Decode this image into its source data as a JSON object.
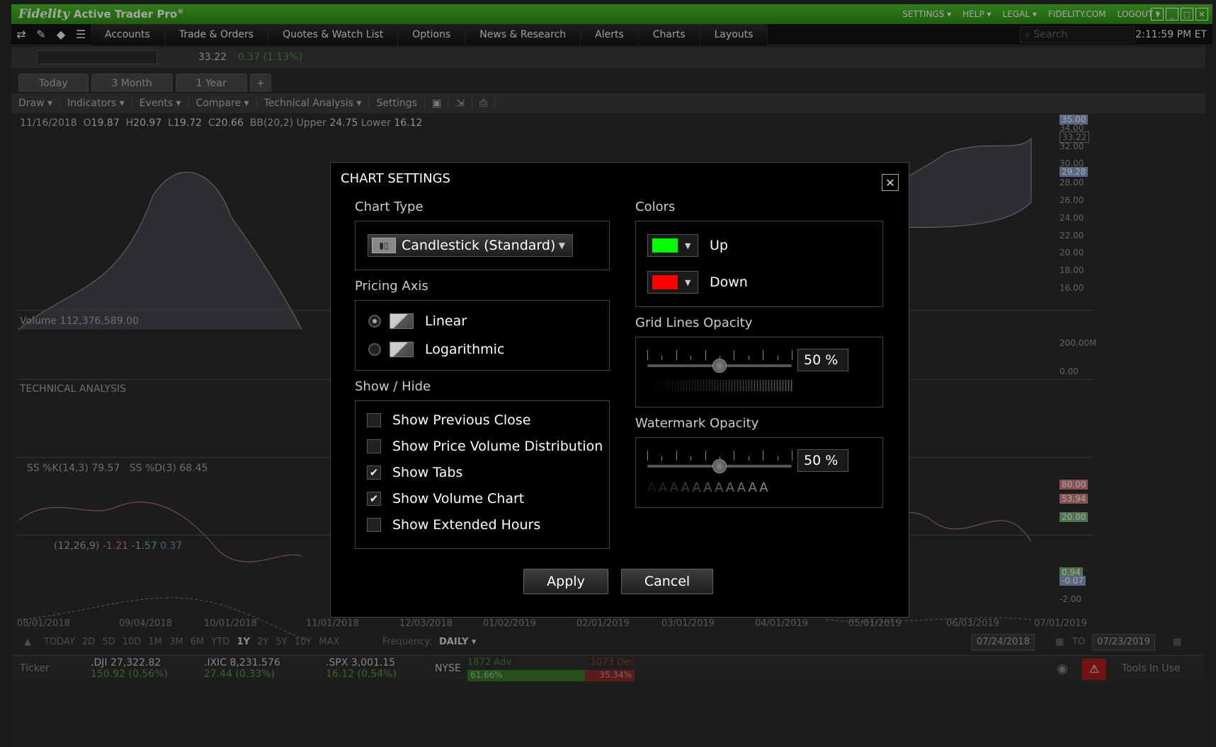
{
  "app": {
    "brand": "Fidelity",
    "title": "Active Trader Pro",
    "reg": "®",
    "top_links": [
      "SETTINGS ▾",
      "HELP ▾",
      "LEGAL ▾",
      "FIDELITY.COM",
      "LOGOUT ▾"
    ],
    "time": "2:11:59 PM ET"
  },
  "menu": {
    "items": [
      "Accounts",
      "Trade & Orders",
      "Quotes & Watch List",
      "Options",
      "News & Research",
      "Alerts",
      "Charts",
      "Layouts"
    ],
    "search_placeholder": "Search"
  },
  "chart": {
    "price": "33.22",
    "change": "0.37 (1.13%)",
    "tabs": [
      "Today",
      "3 Month",
      "1 Year",
      "+"
    ],
    "tools": [
      "Draw ▾",
      "Indicators ▾",
      "Events ▾",
      "Compare ▾",
      "Technical Analysis ▾",
      "Settings"
    ],
    "ohlc": {
      "date": "11/16/2018",
      "open_label": "O",
      "open": "19.87",
      "high_label": "H",
      "high": "20.97",
      "low_label": "L",
      "low": "19.72",
      "close_label": "C",
      "close": "20.66",
      "bb_label": "BB(20,2) Upper",
      "bb_upper": "24.75",
      "bb_lower_label": "Lower",
      "bb_lower": "16.12"
    },
    "volume_label": "Volume",
    "volume_value": "112,376,589.00",
    "technical_analysis_label": "TECHNICAL ANALYSIS",
    "stoch_k_label": "SS %K(14,3)",
    "stoch_k": "79.57",
    "stoch_d_label": "SS %D(3)",
    "stoch_d": "68.45",
    "macd_label": "(12,26,9)",
    "macd_values": [
      "-1.21",
      "-1.57",
      "0.37"
    ],
    "price_axis": [
      "35.00",
      "34.00",
      "33.22",
      "32.00",
      "30.00",
      "29.28",
      "28.00",
      "26.00",
      "24.00",
      "22.00",
      "20.00",
      "18.00",
      "16.00"
    ],
    "volume_axis": [
      "200.00M",
      "0.00"
    ],
    "stoch_axis": [
      "80.00",
      "53.94",
      "20.00"
    ],
    "macd_axis": [
      "0.94",
      "-0.07",
      "-2.00"
    ],
    "x_axis": [
      "08/01/2018",
      "09/04/2018",
      "10/01/2018",
      "11/01/2018",
      "12/03/2018",
      "01/02/2019",
      "02/01/2019",
      "03/01/2019",
      "04/01/2019",
      "05/01/2019",
      "06/03/2019",
      "07/01/2019"
    ],
    "periods": [
      "TODAY",
      "2D",
      "5D",
      "10D",
      "1M",
      "3M",
      "6M",
      "YTD",
      "1Y",
      "2Y",
      "5Y",
      "10Y",
      "MAX"
    ],
    "frequency_label": "Frequency:",
    "frequency": "DAILY ▾",
    "date_from": "07/24/2018",
    "date_to_label": "TO",
    "date_to": "07/23/2019"
  },
  "ticker": {
    "label": "Ticker",
    "items": [
      {
        "sym": ".DJI",
        "val": "27,322.82",
        "chg": "150.92 (0.56%)"
      },
      {
        "sym": ".IXIC",
        "val": "8,231.576",
        "chg": "27.44 (0.33%)"
      },
      {
        "sym": ".SPX",
        "val": "3,001.15",
        "chg": "16.12 (0.54%)"
      }
    ],
    "nyse_label": "NYSE",
    "adv": "1872 Adv",
    "adv_pct": "61.66%",
    "dec": "1073 Dec",
    "dec_pct": "35.34%",
    "tools_in_use": "Tools In Use"
  },
  "dialog": {
    "title": "CHART SETTINGS",
    "chart_type_label": "Chart Type",
    "chart_type_value": "Candlestick (Standard)",
    "pricing_axis_label": "Pricing Axis",
    "pricing_options": [
      {
        "label": "Linear",
        "selected": true
      },
      {
        "label": "Logarithmic",
        "selected": false
      }
    ],
    "show_hide_label": "Show / Hide",
    "show_hide_options": [
      {
        "label": "Show Previous Close",
        "checked": false
      },
      {
        "label": "Show Price Volume Distribution",
        "checked": false
      },
      {
        "label": "Show Tabs",
        "checked": true
      },
      {
        "label": "Show Volume Chart",
        "checked": true
      },
      {
        "label": "Show Extended Hours",
        "checked": false
      }
    ],
    "colors_label": "Colors",
    "up_label": "Up",
    "up_color": "#00ff00",
    "down_label": "Down",
    "down_color": "#ff0000",
    "grid_opacity_label": "Grid Lines Opacity",
    "grid_opacity_value": "50 %",
    "grid_opacity_fraction": 0.5,
    "watermark_opacity_label": "Watermark Opacity",
    "watermark_opacity_value": "50 %",
    "watermark_opacity_fraction": 0.5,
    "watermark_sample": "AAAAAAAAAAA",
    "apply_label": "Apply",
    "cancel_label": "Cancel",
    "close_glyph": "✕"
  }
}
